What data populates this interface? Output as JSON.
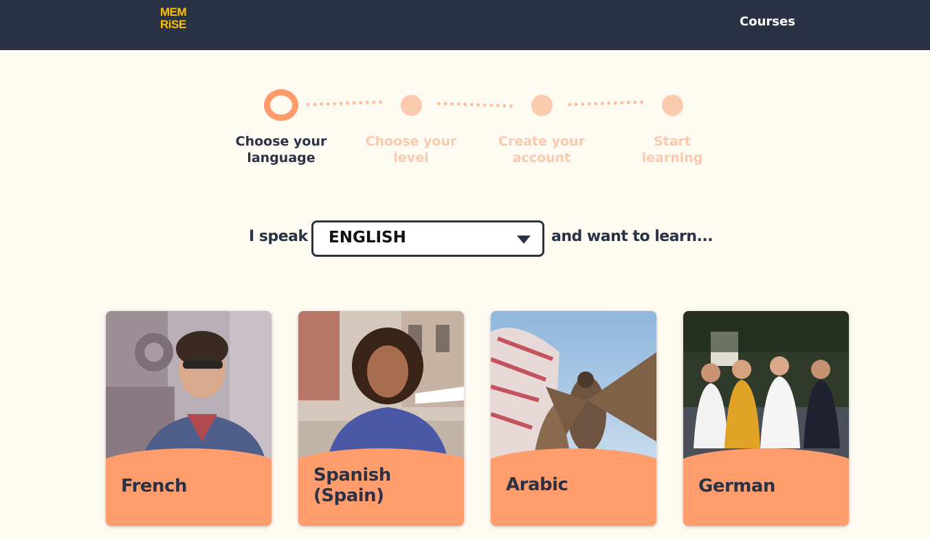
{
  "header": {
    "logo_line1": "MEM",
    "logo_line2": "RiSE",
    "nav_courses": "Courses"
  },
  "stepper": {
    "steps": [
      {
        "label_line1": "Choose your",
        "label_line2": "language",
        "active": true
      },
      {
        "label_line1": "Choose your",
        "label_line2": "level",
        "active": false
      },
      {
        "label_line1": "Create your",
        "label_line2": "account",
        "active": false
      },
      {
        "label_line1": "Start",
        "label_line2": "learning",
        "active": false
      }
    ]
  },
  "language_select": {
    "prefix": "I speak",
    "value": "ENGLISH",
    "suffix": "and want to learn..."
  },
  "courses": [
    {
      "title": "French"
    },
    {
      "title_line1": "Spanish",
      "title_line2": "(Spain)"
    },
    {
      "title": "Arabic"
    },
    {
      "title": "German"
    }
  ],
  "colors": {
    "header_bg": "#2b3245",
    "page_bg": "#fdfaf2",
    "accent": "#ff9d6d",
    "logo": "#ffc000",
    "muted_step": "#fbc9ad"
  }
}
